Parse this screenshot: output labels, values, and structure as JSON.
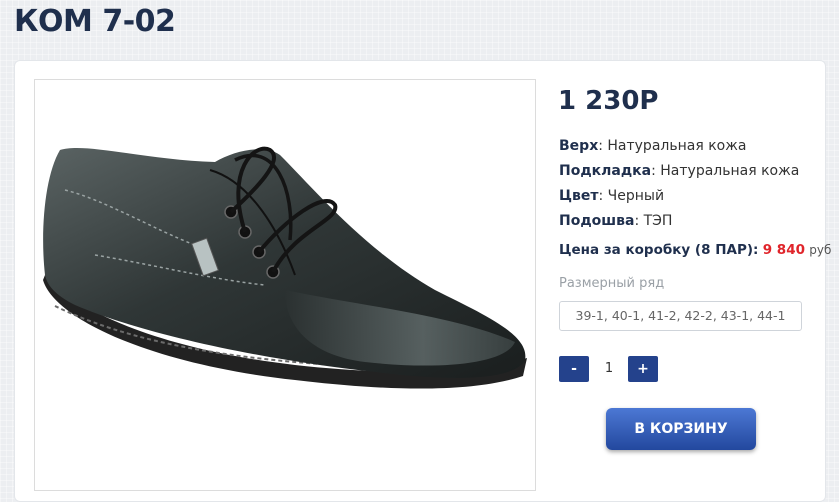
{
  "product": {
    "title": "КОМ 7-02",
    "price": "1 230Р",
    "image_alt": "black leather men's shoe"
  },
  "attributes": [
    {
      "label": "Верх",
      "value": ": Натуральная кожа"
    },
    {
      "label": "Подкладка",
      "value": ": Натуральная кожа"
    },
    {
      "label": "Цвет",
      "value": ": Черный"
    },
    {
      "label": "Подошва",
      "value": ": ТЭП"
    }
  ],
  "box_price": {
    "label": "Цена за коробку (8 ПАР):",
    "value": "9 840",
    "currency": "руб"
  },
  "sizes": {
    "label": "Размерный ряд",
    "value": "39-1, 40-1, 41-2, 42-2, 43-1, 44-1"
  },
  "quantity": {
    "minus": "-",
    "value": "1",
    "plus": "+"
  },
  "cart_button": "В КОРЗИНУ",
  "colors": {
    "accent": "#24428c",
    "title": "#1f2f4d",
    "price_red": "#e0252b"
  }
}
